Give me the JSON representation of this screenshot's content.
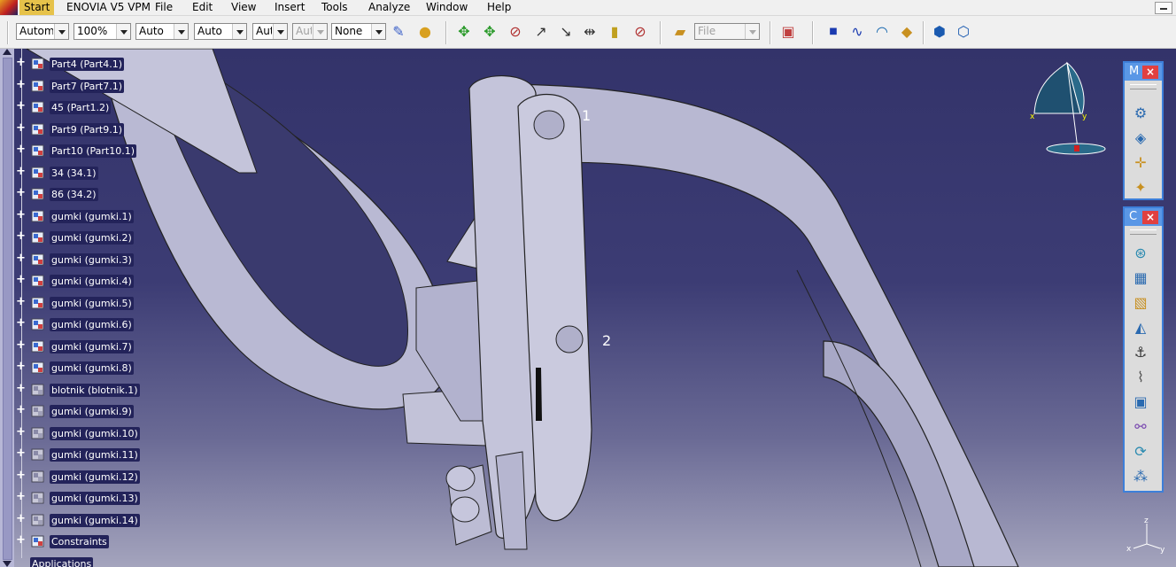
{
  "menubar": {
    "items": [
      "Start",
      "ENOVIA V5 VPM",
      "File",
      "Edit",
      "View",
      "Insert",
      "Tools",
      "Analyze",
      "Window",
      "Help"
    ]
  },
  "toolbar": {
    "combos": [
      "Automa",
      "100%",
      "Auto",
      "Auto",
      "Aut",
      "Aut",
      "None"
    ],
    "file_combo": "File"
  },
  "tree": {
    "items": [
      "Part4 (Part4.1)",
      "Part7 (Part7.1)",
      "45 (Part1.2)",
      "Part9 (Part9.1)",
      "Part10 (Part10.1)",
      "34 (34.1)",
      "86 (34.2)",
      "gumki (gumki.1)",
      "gumki (gumki.2)",
      "gumki (gumki.3)",
      "gumki (gumki.4)",
      "gumki (gumki.5)",
      "gumki (gumki.6)",
      "gumki (gumki.7)",
      "gumki (gumki.8)",
      "blotnik (blotnik.1)",
      "gumki (gumki.9)",
      "gumki (gumki.10)",
      "gumki (gumki.11)",
      "gumki (gumki.12)",
      "gumki (gumki.13)",
      "gumki (gumki.14)",
      "Constraints",
      "Applications"
    ]
  },
  "palettes": {
    "first": {
      "title": "M",
      "close": "×"
    },
    "second": {
      "title": "C",
      "close": "×"
    }
  },
  "viewport": {
    "hole_label_1": "1",
    "hole_label_2": "2",
    "compass_x": "x",
    "compass_y": "y",
    "axis_x": "x",
    "axis_y": "y",
    "axis_z": "z"
  },
  "colors": {
    "background_top": "#33336a",
    "background_bottom": "#a4a4bd",
    "part_fill": "#c8c8dc",
    "tree_label_bg": "#23235a",
    "palette_border": "#3d7fd9"
  }
}
